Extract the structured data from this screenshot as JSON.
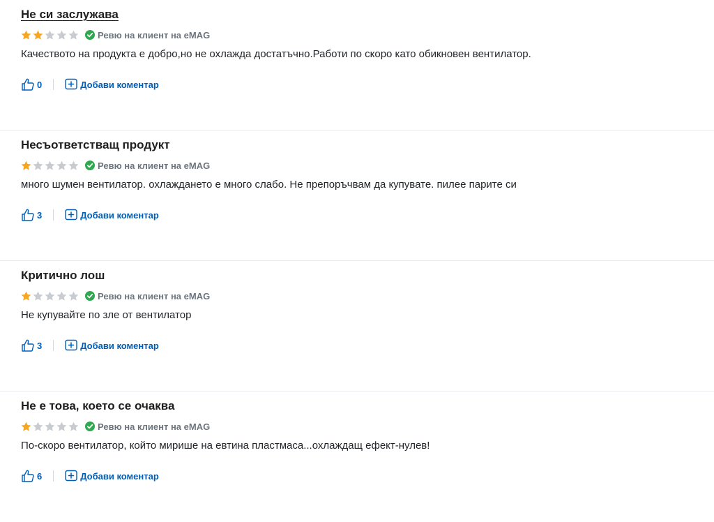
{
  "reviews": [
    {
      "title": "Не си заслужава",
      "rating": 2,
      "verified_label": "Ревю на клиент на eMAG",
      "body": "Качеството на продукта е добро,но не охлажда достатъчно.Работи по скоро като обикновен вентилатор.",
      "likes": "0",
      "comment_label": "Добави коментар"
    },
    {
      "title": "Несъответстващ продукт",
      "rating": 1,
      "verified_label": "Ревю на клиент на eMAG",
      "body": "много шумен вентилатор. охлаждането е много слабо. Не препоръчвам да купувате. пилее парите си",
      "likes": "3",
      "comment_label": "Добави коментар"
    },
    {
      "title": "Критично лош",
      "rating": 1,
      "verified_label": "Ревю на клиент на eMAG",
      "body": "Не купувайте по зле от вентилатор",
      "likes": "3",
      "comment_label": "Добави коментар"
    },
    {
      "title": "Не е това, което се очаква",
      "rating": 1,
      "verified_label": "Ревю на клиент на eMAG",
      "body": "По-скоро вентилатор, който мирише на евтина пластмаса...охлаждащ ефект-нулев!",
      "likes": "6",
      "comment_label": "Добави коментар"
    }
  ],
  "colors": {
    "star_filled": "#f5a623",
    "star_empty": "#c8cbd0",
    "verified_green": "#2fa84f",
    "link_blue": "#005eb8"
  },
  "icons": {
    "star": "star-icon",
    "verified": "verified-check-icon",
    "like": "thumbs-up-icon",
    "comment": "add-comment-icon"
  }
}
